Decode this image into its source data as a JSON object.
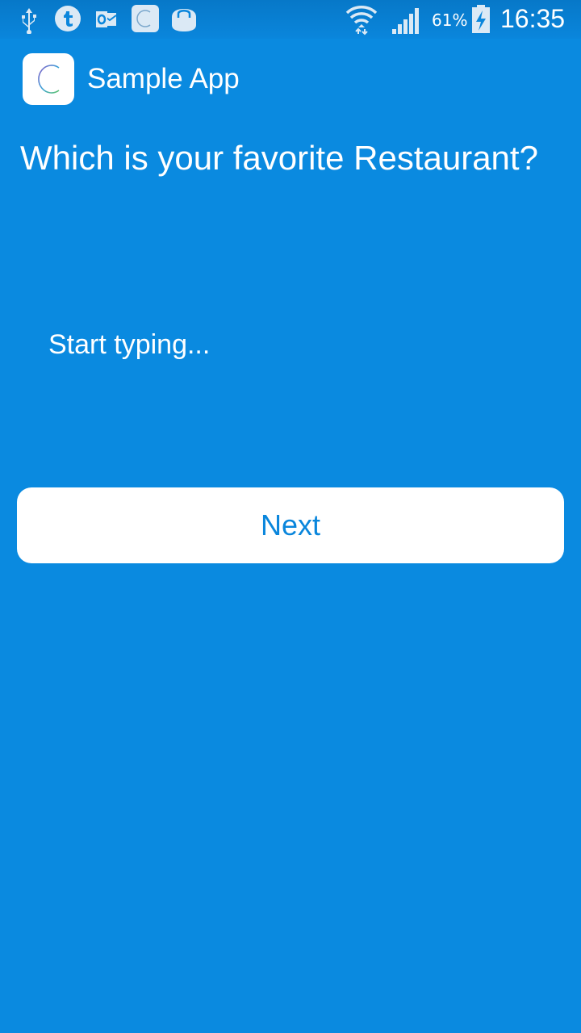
{
  "status_bar": {
    "icons": [
      "usb-icon",
      "tumblr-icon",
      "outlook-icon",
      "app-notification-icon",
      "shopping-bag-icon",
      "wifi-icon",
      "signal-icon",
      "battery-charging-icon"
    ],
    "battery_percent": "61%",
    "time": "16:35"
  },
  "app_bar": {
    "title": "Sample App",
    "logo_icon": "app-logo-icon"
  },
  "main": {
    "question": "Which is your favorite Restaurant?",
    "answer_input": {
      "value": "",
      "placeholder": "Start typing..."
    },
    "next_label": "Next"
  },
  "colors": {
    "background": "#0a8ae0",
    "button_background": "#ffffff",
    "button_text": "#0a86dc"
  }
}
